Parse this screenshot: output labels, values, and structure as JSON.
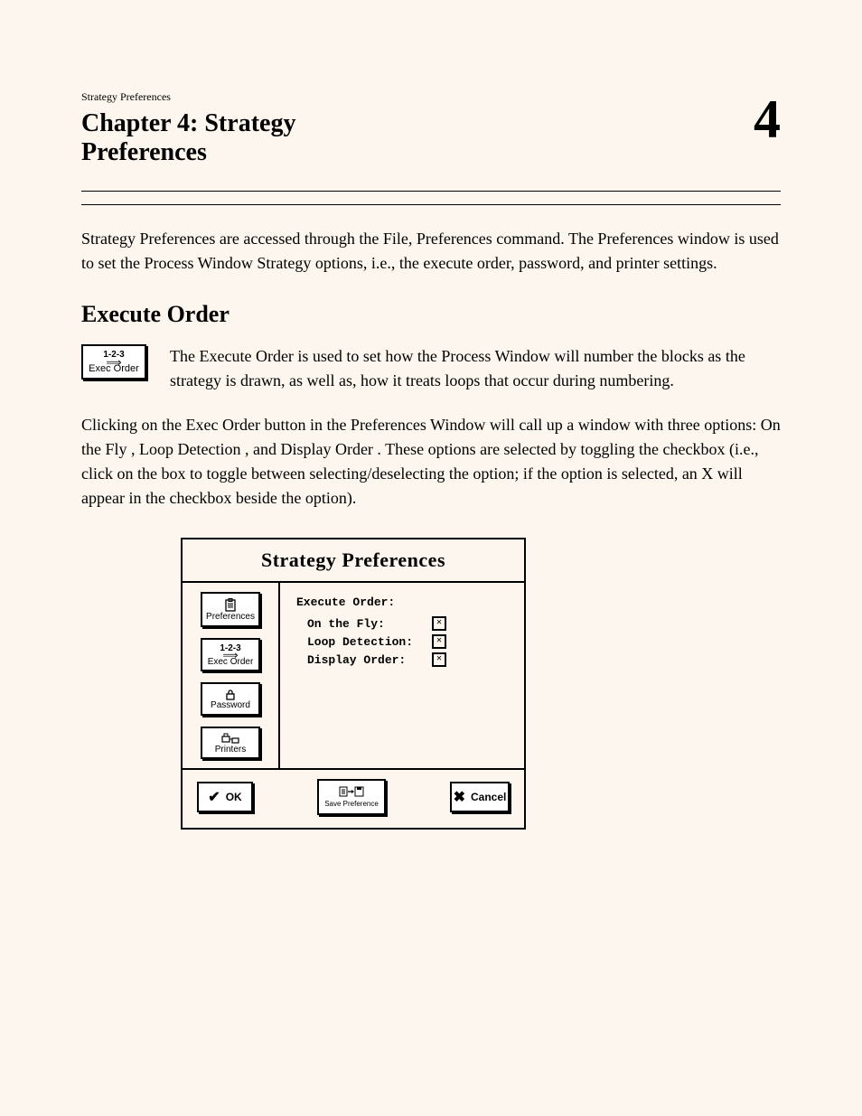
{
  "header": {
    "eyebrow": "Strategy Preferences",
    "chapter_number": "4",
    "chapter_title_line1": "Chapter 4: Strategy",
    "chapter_title_line2": "Preferences",
    "intro": "Strategy Preferences are accessed through the  File, Preferences  command. The  Preferences  window is used to set the Process Window Strategy options, i.e., the execute order, password, and printer settings."
  },
  "section": {
    "title": "Execute Order",
    "toolbutton": {
      "line1": "1-2-3",
      "line2": "Exec Order"
    },
    "lead": "The  Execute Order  is used to set how the Process Window will number the blocks as the strategy is drawn, as well as, how it treats loops that occur during numbering.",
    "body": "Clicking on the  Exec Order  button in the  Preferences Window  will call up a window with three options:  On the Fly ,  Loop Detection , and  Display Order . These options are selected by toggling the checkbox (i.e., click on the box to toggle between selecting/deselecting the option; if the option is selected, an  X  will appear in the checkbox beside the option)."
  },
  "dialog": {
    "title": "Strategy Preferences",
    "side_buttons": [
      {
        "name": "preferences",
        "label": "Preferences"
      },
      {
        "name": "exec-order",
        "line1": "1-2-3",
        "label": "Exec Order"
      },
      {
        "name": "password",
        "label": "Password"
      },
      {
        "name": "printers",
        "label": "Printers"
      }
    ],
    "group_title": "Execute Order:",
    "options": [
      {
        "label": "On the Fly:",
        "checked": true
      },
      {
        "label": "Loop Detection:",
        "checked": true
      },
      {
        "label": "Display Order:",
        "checked": true
      }
    ],
    "footer": {
      "ok": "OK",
      "save": "Save Preference",
      "cancel": "Cancel"
    }
  }
}
